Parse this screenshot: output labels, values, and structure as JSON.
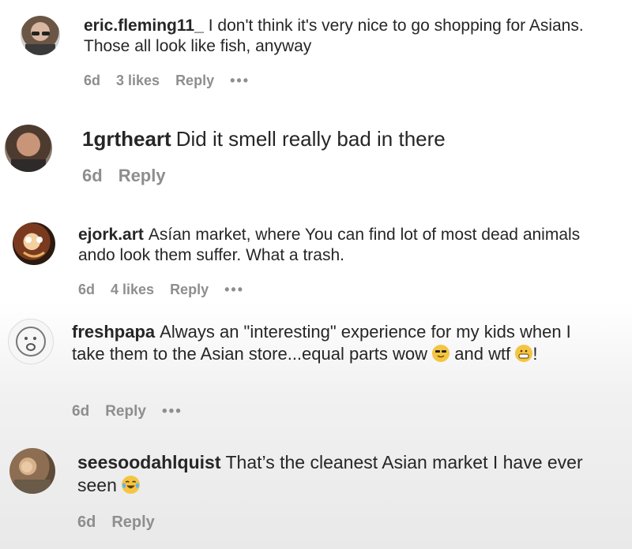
{
  "comments": [
    {
      "username": "eric.fleming11_",
      "text": "I don't think it's very nice to go shopping for Asians. Those all look like fish, anyway",
      "time": "6d",
      "likes": "3 likes",
      "reply": "Reply",
      "more": "•••"
    },
    {
      "username": "1grtheart",
      "text": "Did it smell really bad in there",
      "time": "6d",
      "reply": "Reply"
    },
    {
      "username": "ejork.art",
      "text": "Asían market, where You can find lot of most dead animals ando look them suffer. What a trash.",
      "time": "6d",
      "likes": "4 likes",
      "reply": "Reply",
      "more": "•••"
    },
    {
      "username": "freshpapa",
      "text_before": "Always an \"interesting\" experience for my kids when I take them to the Asian store...equal parts wow",
      "text_middle": "and wtf",
      "text_end": "!",
      "time": "6d",
      "reply": "Reply",
      "more": "•••"
    },
    {
      "username": "seesoodahlquist",
      "text": "That’s the cleanest Asian market I have ever seen",
      "time": "6d",
      "reply": "Reply"
    }
  ],
  "icons": {
    "like": "heart-outline-icon",
    "emoji_sunglasses": "sunglasses-face-emoji",
    "emoji_grimace": "grimacing-face-emoji",
    "emoji_laugh": "tears-of-joy-emoji"
  }
}
